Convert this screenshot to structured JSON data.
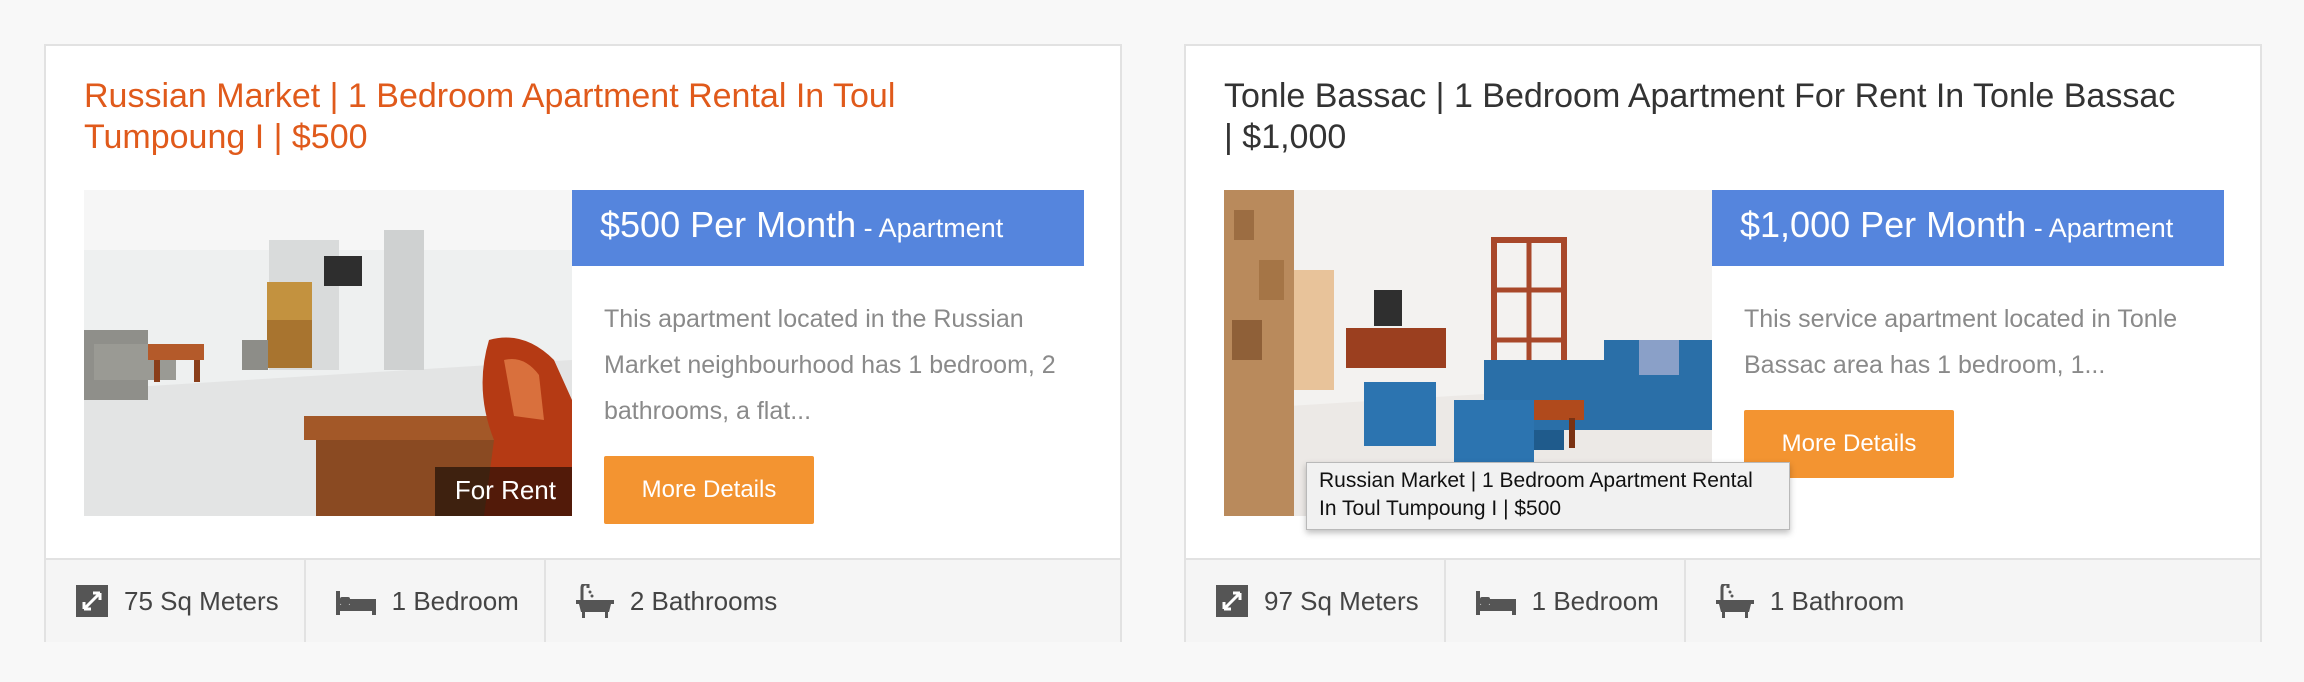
{
  "listings": [
    {
      "title": "Russian Market | 1 Bedroom Apartment Rental In Toul Tumpoung I | $500",
      "price_main": "$500 Per Month",
      "price_sub": " - Apartment",
      "description": "This apartment located in the Russian Market neighbourhood has 1 bedroom, 2 bathrooms, a flat...",
      "badge": "For Rent",
      "button_label": "More Details",
      "features": {
        "area": "75 Sq Meters",
        "bedrooms": "1 Bedroom",
        "bathrooms": "2 Bathrooms"
      }
    },
    {
      "title": "Tonle Bassac | 1 Bedroom Apartment For Rent In Tonle Bassac | $1,000",
      "price_main": "$1,000 Per Month",
      "price_sub": " - Apartment",
      "description": "This service apartment located in Tonle Bassac area has 1 bedroom, 1...",
      "button_label": "More Details",
      "features": {
        "area": "97 Sq Meters",
        "bedrooms": "1 Bedroom",
        "bathrooms": "1 Bathroom"
      }
    }
  ],
  "tooltip": "Russian Market | 1 Bedroom Apartment Rental In Toul Tumpoung I | $500",
  "colors": {
    "title_link": "#e05a1b",
    "price_bar": "#5585dd",
    "button": "#f39431"
  },
  "icons": [
    "expand-area-icon",
    "bed-icon",
    "bathtub-icon"
  ]
}
